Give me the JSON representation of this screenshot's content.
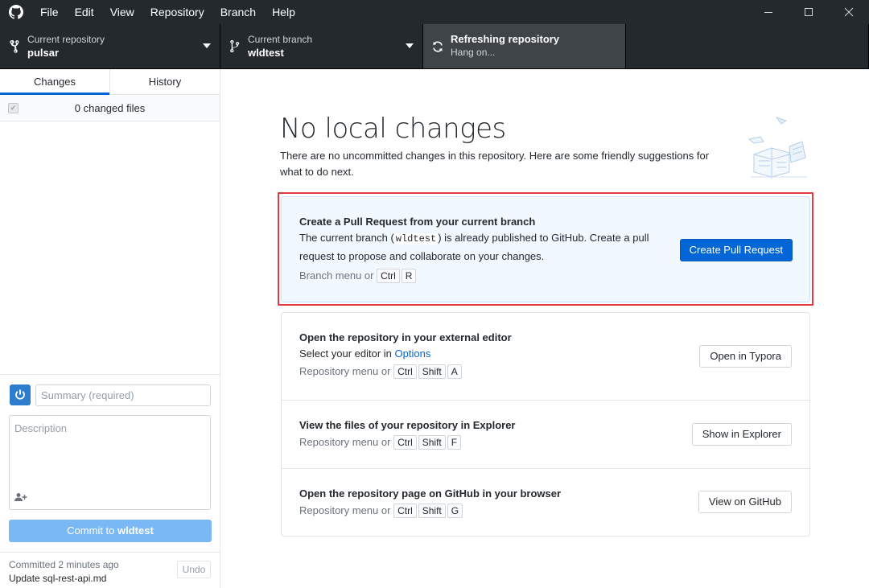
{
  "menu": [
    "File",
    "Edit",
    "View",
    "Repository",
    "Branch",
    "Help"
  ],
  "toolbar": {
    "repo_label": "Current repository",
    "repo_value": "pulsar",
    "branch_label": "Current branch",
    "branch_value": "wldtest",
    "fetch_label": "Refreshing repository",
    "fetch_value": "Hang on..."
  },
  "sidebar": {
    "tabs": [
      "Changes",
      "History"
    ],
    "active_tab": "Changes",
    "changed_files": "0 changed files",
    "summary_placeholder": "Summary (required)",
    "description_placeholder": "Description",
    "commit_prefix": "Commit to ",
    "commit_branch": "wldtest",
    "last_commit_time": "Committed 2 minutes ago",
    "last_commit_message": "Update sql-rest-api.md",
    "undo_label": "Undo"
  },
  "main": {
    "title": "No local changes",
    "subtitle": "There are no uncommitted changes in this repository. Here are some friendly suggestions for what to do next.",
    "pull_request": {
      "title": "Create a Pull Request from your current branch",
      "desc_before": "The current branch (",
      "branch": "wldtest",
      "desc_after": ") is already published to GitHub. Create a pull request to propose and collaborate on your changes.",
      "shortcut_prefix": "Branch menu or",
      "keys": [
        "Ctrl",
        "R"
      ],
      "button": "Create Pull Request"
    },
    "editor": {
      "title": "Open the repository in your external editor",
      "desc_before": "Select your editor in ",
      "link": "Options",
      "shortcut_prefix": "Repository menu or",
      "keys": [
        "Ctrl",
        "Shift",
        "A"
      ],
      "button": "Open in Typora"
    },
    "explorer": {
      "title": "View the files of your repository in Explorer",
      "shortcut_prefix": "Repository menu or",
      "keys": [
        "Ctrl",
        "Shift",
        "F"
      ],
      "button": "Show in Explorer"
    },
    "github": {
      "title": "Open the repository page on GitHub in your browser",
      "shortcut_prefix": "Repository menu or",
      "keys": [
        "Ctrl",
        "Shift",
        "G"
      ],
      "button": "View on GitHub"
    }
  },
  "colors": {
    "accent": "#0366d6",
    "highlight": "#e0393e",
    "titlebar": "#24292e"
  }
}
